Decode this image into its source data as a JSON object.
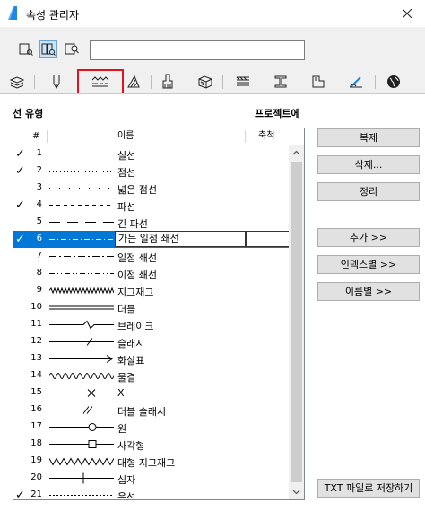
{
  "window": {
    "title": "속성 관리자"
  },
  "search": {
    "value": ""
  },
  "headers": {
    "line_types": "선 유형",
    "project": "프로젝트에"
  },
  "columns": {
    "num": "#",
    "name": "이름",
    "scale": "축척"
  },
  "colors": {
    "selection": "#0078d7",
    "highlight_box": "#e0141e"
  },
  "rows": [
    {
      "num": "1",
      "name": "실선",
      "checked": true,
      "style": "solid"
    },
    {
      "num": "2",
      "name": "점선",
      "checked": true,
      "style": "dotted"
    },
    {
      "num": "3",
      "name": "넓은 점선",
      "checked": false,
      "style": "wide-dotted"
    },
    {
      "num": "4",
      "name": "파선",
      "checked": true,
      "style": "dashed"
    },
    {
      "num": "5",
      "name": "긴 파선",
      "checked": false,
      "style": "long-dashed"
    },
    {
      "num": "6",
      "name": "가는 일점 쇄선",
      "checked": true,
      "style": "dash-dot-fine",
      "selected": true
    },
    {
      "num": "7",
      "name": "일점 쇄선",
      "checked": false,
      "style": "dash-dot"
    },
    {
      "num": "8",
      "name": "이점 쇄선",
      "checked": false,
      "style": "dash-dot-dot"
    },
    {
      "num": "9",
      "name": "지그재그",
      "checked": false,
      "style": "zigzag"
    },
    {
      "num": "10",
      "name": "더블",
      "checked": false,
      "style": "double"
    },
    {
      "num": "11",
      "name": "브레이크",
      "checked": false,
      "style": "break"
    },
    {
      "num": "12",
      "name": "슬래시",
      "checked": false,
      "style": "slash"
    },
    {
      "num": "13",
      "name": "화살표",
      "checked": false,
      "style": "arrow"
    },
    {
      "num": "14",
      "name": "물결",
      "checked": false,
      "style": "wave"
    },
    {
      "num": "15",
      "name": "X",
      "checked": false,
      "style": "x"
    },
    {
      "num": "16",
      "name": "더블 슬래시",
      "checked": false,
      "style": "double-slash"
    },
    {
      "num": "17",
      "name": "원",
      "checked": false,
      "style": "circle"
    },
    {
      "num": "18",
      "name": "사각형",
      "checked": false,
      "style": "square"
    },
    {
      "num": "19",
      "name": "대형 지그재그",
      "checked": false,
      "style": "big-zigzag"
    },
    {
      "num": "20",
      "name": "십자",
      "checked": false,
      "style": "cross"
    },
    {
      "num": "21",
      "name": "은선",
      "checked": true,
      "style": "hidden"
    }
  ],
  "buttons": {
    "duplicate": "복제",
    "delete": "삭제...",
    "purge": "정리",
    "add": "추가 >>",
    "by_index": "인덱스별 >>",
    "by_name": "이름별 >>",
    "save_txt": "TXT 파일로 저장하기"
  },
  "icons": {
    "view_list": "list-view-icon",
    "view_grid": "grid-view-icon",
    "view_search": "search-view-icon",
    "tabs": [
      "layers-icon",
      "pen-icon",
      "line-type-icon",
      "fill-icon",
      "surface-icon",
      "building-material-icon",
      "composite-icon",
      "profile-icon",
      "zone-icon",
      "markup-icon",
      "globe-icon"
    ]
  }
}
